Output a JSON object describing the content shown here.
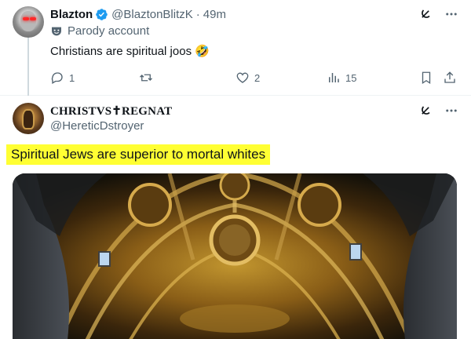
{
  "tweet1": {
    "name": "Blazton",
    "handle": "@BlaztonBlitzK",
    "separator": "·",
    "time": "49m",
    "label": "Parody account",
    "text": "Christians are spiritual joos 🤣",
    "replies": "1",
    "reposts": "",
    "likes": "2",
    "views": "15"
  },
  "tweet2": {
    "name": "CHRISTVS✝REGNAT",
    "handle": "@HereticDstroyer",
    "highlight_text": "Spiritual Jews are superior to mortal whites",
    "highlight_color": "#ffff33"
  },
  "icons": {
    "grok": "grok-icon",
    "more": "more-icon",
    "reply": "reply-icon",
    "repost": "repost-icon",
    "like": "like-icon",
    "views": "views-icon",
    "bookmark": "bookmark-icon",
    "share": "share-icon"
  },
  "colors": {
    "verified": "#1d9bf0",
    "secondary_text": "#536471"
  }
}
